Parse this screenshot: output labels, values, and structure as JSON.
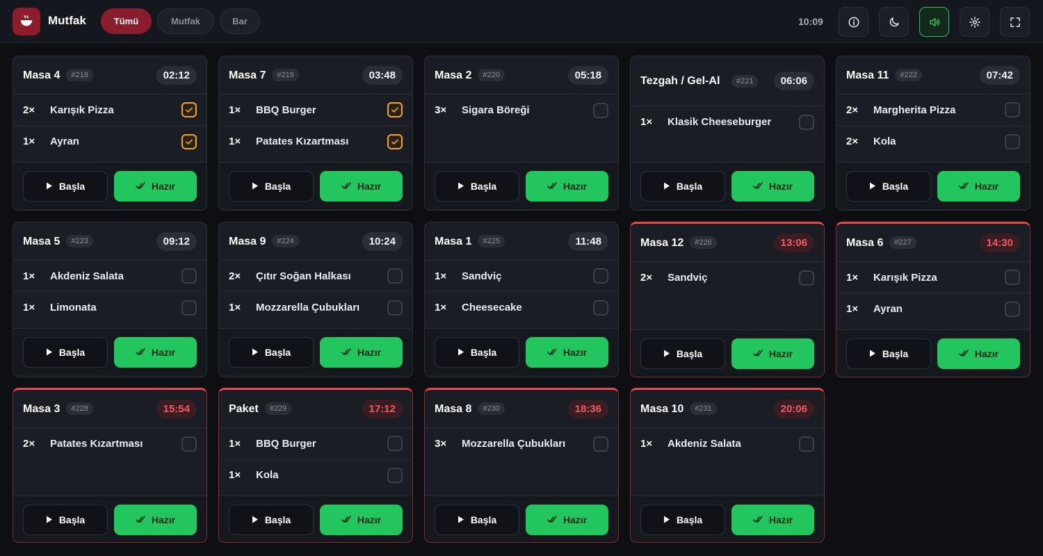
{
  "header": {
    "brand": "Mutfak",
    "tabs": [
      "Tümü",
      "Mutfak",
      "Bar"
    ],
    "active_tab": "Tümü",
    "time": "10:09",
    "tools": [
      "info-icon",
      "moon-icon",
      "speaker-icon",
      "gear-icon",
      "fullscreen-icon"
    ],
    "sound_on": true
  },
  "labels": {
    "start": "Başla",
    "ready": "Hazır"
  },
  "colors": {
    "accent": "#8a1d2c",
    "ready": "#22c55e",
    "late": "#e5484d",
    "checked": "#f5a524"
  },
  "orders": [
    {
      "title": "Masa 4",
      "num": "#218",
      "timer": "02:12",
      "late": false,
      "items": [
        {
          "qty": "2×",
          "name": "Karışık Pizza",
          "checked": true
        },
        {
          "qty": "1×",
          "name": "Ayran",
          "checked": true
        }
      ]
    },
    {
      "title": "Masa 7",
      "num": "#219",
      "timer": "03:48",
      "late": false,
      "items": [
        {
          "qty": "1×",
          "name": "BBQ Burger",
          "checked": true
        },
        {
          "qty": "1×",
          "name": "Patates Kızartması",
          "checked": true
        }
      ]
    },
    {
      "title": "Masa 2",
      "num": "#220",
      "timer": "05:18",
      "late": false,
      "items": [
        {
          "qty": "3×",
          "name": "Sigara Böreği",
          "checked": false
        }
      ]
    },
    {
      "title": "Tezgah / Gel-Al",
      "num": "#221",
      "timer": "06:06",
      "late": false,
      "items": [
        {
          "qty": "1×",
          "name": "Klasik Cheeseburger",
          "checked": false
        }
      ]
    },
    {
      "title": "Masa 11",
      "num": "#222",
      "timer": "07:42",
      "late": false,
      "items": [
        {
          "qty": "2×",
          "name": "Margherita Pizza",
          "checked": false
        },
        {
          "qty": "2×",
          "name": "Kola",
          "checked": false
        }
      ]
    },
    {
      "title": "Masa 5",
      "num": "#223",
      "timer": "09:12",
      "late": false,
      "items": [
        {
          "qty": "1×",
          "name": "Akdeniz Salata",
          "checked": false
        },
        {
          "qty": "1×",
          "name": "Limonata",
          "checked": false
        }
      ]
    },
    {
      "title": "Masa 9",
      "num": "#224",
      "timer": "10:24",
      "late": false,
      "items": [
        {
          "qty": "2×",
          "name": "Çıtır Soğan Halkası",
          "checked": false
        },
        {
          "qty": "1×",
          "name": "Mozzarella Çubukları",
          "checked": false
        }
      ]
    },
    {
      "title": "Masa 1",
      "num": "#225",
      "timer": "11:48",
      "late": false,
      "items": [
        {
          "qty": "1×",
          "name": "Sandviç",
          "checked": false
        },
        {
          "qty": "1×",
          "name": "Cheesecake",
          "checked": false
        }
      ]
    },
    {
      "title": "Masa 12",
      "num": "#226",
      "timer": "13:06",
      "late": true,
      "items": [
        {
          "qty": "2×",
          "name": "Sandviç",
          "checked": false
        }
      ]
    },
    {
      "title": "Masa 6",
      "num": "#227",
      "timer": "14:30",
      "late": true,
      "items": [
        {
          "qty": "1×",
          "name": "Karışık Pizza",
          "checked": false
        },
        {
          "qty": "1×",
          "name": "Ayran",
          "checked": false
        }
      ]
    },
    {
      "title": "Masa 3",
      "num": "#228",
      "timer": "15:54",
      "late": true,
      "items": [
        {
          "qty": "2×",
          "name": "Patates Kızartması",
          "checked": false
        }
      ]
    },
    {
      "title": "Paket",
      "num": "#229",
      "timer": "17:12",
      "late": true,
      "items": [
        {
          "qty": "1×",
          "name": "BBQ Burger",
          "checked": false
        },
        {
          "qty": "1×",
          "name": "Kola",
          "checked": false
        }
      ]
    },
    {
      "title": "Masa 8",
      "num": "#230",
      "timer": "18:36",
      "late": true,
      "items": [
        {
          "qty": "3×",
          "name": "Mozzarella Çubukları",
          "checked": false
        }
      ]
    },
    {
      "title": "Masa 10",
      "num": "#231",
      "timer": "20:06",
      "late": true,
      "items": [
        {
          "qty": "1×",
          "name": "Akdeniz Salata",
          "checked": false
        }
      ]
    }
  ]
}
